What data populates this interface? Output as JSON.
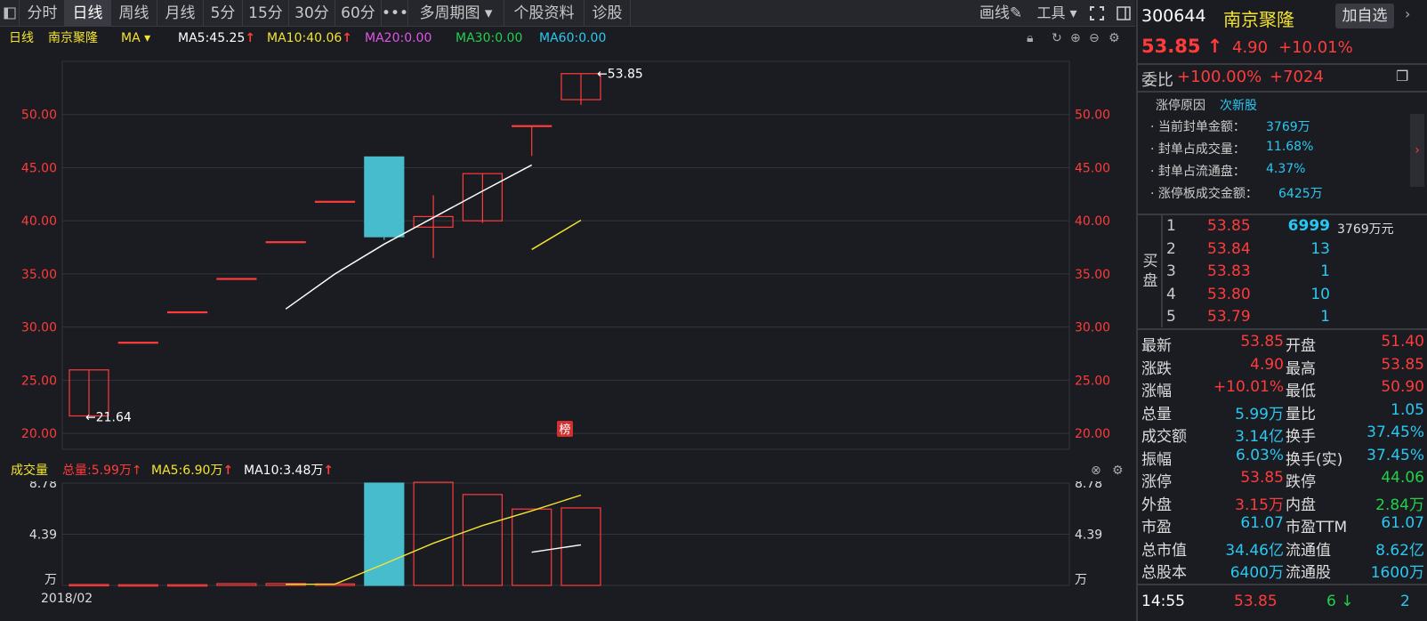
{
  "tabs": [
    "分时",
    "日线",
    "周线",
    "月线",
    "5分",
    "15分",
    "30分",
    "60分",
    "•••",
    "多周期图 ▾",
    "个股资料",
    "诊股"
  ],
  "active_tab": "日线",
  "toolbar": {
    "draw": "画线",
    "tools": "工具 ▾"
  },
  "indicator": {
    "period": "日线",
    "stock": "南京聚隆",
    "ma_select": "MA ▾",
    "ma5": "MA5:45.25",
    "ma10": "MA10:40.06",
    "ma20": "MA20:0.00",
    "ma30": "MA30:0.00",
    "ma60": "MA60:0.00"
  },
  "volume_header": {
    "label": "成交量",
    "total": "总量:5.99万",
    "ma5": "MA5:6.90万",
    "ma10": "MA10:3.48万"
  },
  "colors": {
    "up": "#ff3b3b",
    "down": "#46bccd",
    "ma5": "#ffffff",
    "ma10": "#f3e432",
    "ma20": "#e055e8",
    "ma30": "#1fd14b",
    "ma60": "#29c8f2"
  },
  "chart_data": {
    "type": "candlestick",
    "price_axis": {
      "ylim": [
        18.5,
        55
      ],
      "ticks": [
        "50.00",
        "45.00",
        "40.00",
        "35.00",
        "30.00",
        "25.00",
        "20.00"
      ]
    },
    "candles": [
      {
        "open": 21.64,
        "close": 25.97,
        "high": 25.97,
        "low": 21.64
      },
      {
        "open": 28.57,
        "close": 28.57,
        "high": 28.57,
        "low": 28.57
      },
      {
        "open": 31.43,
        "close": 31.43,
        "high": 31.43,
        "low": 31.43
      },
      {
        "open": 34.57,
        "close": 34.57,
        "high": 34.57,
        "low": 34.57
      },
      {
        "open": 38.03,
        "close": 38.03,
        "high": 38.03,
        "low": 38.03
      },
      {
        "open": 41.83,
        "close": 41.83,
        "high": 41.83,
        "low": 41.83
      },
      {
        "open": 46.01,
        "close": 38.5,
        "high": 46.01,
        "low": 38.2
      },
      {
        "open": 39.4,
        "close": 40.4,
        "high": 42.4,
        "low": 36.5
      },
      {
        "open": 40.0,
        "close": 44.44,
        "high": 44.44,
        "low": 39.8
      },
      {
        "open": 48.95,
        "close": 48.95,
        "high": 48.95,
        "low": 46.1
      },
      {
        "open": 51.4,
        "close": 53.85,
        "high": 53.85,
        "low": 50.9
      }
    ],
    "ma5": [
      null,
      null,
      null,
      null,
      31.7,
      35.0,
      37.8,
      40.3,
      42.8,
      45.25
    ],
    "ma10": [
      null,
      null,
      null,
      null,
      null,
      null,
      null,
      null,
      null,
      37.3,
      40.06
    ],
    "annotations": {
      "max_label": "←53.85",
      "min_label": "←21.64"
    },
    "volume": {
      "axis_labels": [
        "8.78",
        "4.39",
        "万"
      ],
      "ylim": [
        0,
        8.78
      ],
      "values": [
        0.08,
        0.06,
        0.06,
        0.15,
        0.16,
        0.13,
        8.78,
        8.85,
        7.8,
        6.55,
        6.65
      ],
      "ma5": [
        null,
        null,
        null,
        null,
        0.1,
        0.11,
        1.84,
        3.62,
        5.14,
        6.4,
        7.75
      ],
      "ma10": [
        null,
        null,
        null,
        null,
        null,
        null,
        null,
        null,
        null,
        2.85,
        3.48
      ]
    },
    "x_label": "2018/02",
    "badge": "榜"
  },
  "quote": {
    "code": "300644",
    "name": "南京聚隆",
    "add_button": "加自选",
    "price": "53.85 ↑",
    "change": "4.90",
    "change_pct": "+10.01%",
    "weibi_label": "委比",
    "weibi": "+100.00%",
    "weicha": "+7024",
    "limit_reason_label": "涨停原因",
    "limit_reason": "次新股",
    "info": [
      {
        "label": "· 当前封单金额：",
        "value": "3769万"
      },
      {
        "label": "· 封单占成交量：",
        "value": "11.68%"
      },
      {
        "label": "· 封单占流通盘：",
        "value": "4.37%"
      },
      {
        "label": "· 涨停板成交金额：",
        "value": "6425万"
      }
    ],
    "bid_label": "买盘",
    "bids": [
      {
        "level": "1",
        "price": "53.85",
        "volume": "6999",
        "amount": "3769万元"
      },
      {
        "level": "2",
        "price": "53.84",
        "volume": "13",
        "amount": ""
      },
      {
        "level": "3",
        "price": "53.83",
        "volume": "1",
        "amount": ""
      },
      {
        "level": "4",
        "price": "53.80",
        "volume": "10",
        "amount": ""
      },
      {
        "level": "5",
        "price": "53.79",
        "volume": "1",
        "amount": ""
      }
    ],
    "stats": [
      {
        "l1": "最新",
        "v1": "53.85",
        "c1": "red",
        "l2": "开盘",
        "v2": "51.40",
        "c2": "red"
      },
      {
        "l1": "涨跌",
        "v1": "4.90",
        "c1": "red",
        "l2": "最高",
        "v2": "53.85",
        "c2": "red"
      },
      {
        "l1": "涨幅",
        "v1": "+10.01%",
        "c1": "red",
        "l2": "最低",
        "v2": "50.90",
        "c2": "red"
      },
      {
        "l1": "总量",
        "v1": "5.99万",
        "c1": "cyan",
        "l2": "量比",
        "v2": "1.05",
        "c2": "cyan"
      },
      {
        "l1": "成交额",
        "v1": "3.14亿",
        "c1": "cyan",
        "l2": "换手",
        "v2": "37.45%",
        "c2": "cyan"
      },
      {
        "l1": "振幅",
        "v1": "6.03%",
        "c1": "cyan",
        "l2": "换手(实)",
        "v2": "37.45%",
        "c2": "cyan"
      },
      {
        "l1": "涨停",
        "v1": "53.85",
        "c1": "red",
        "l2": "跌停",
        "v2": "44.06",
        "c2": "green"
      },
      {
        "l1": "外盘",
        "v1": "3.15万",
        "c1": "red",
        "l2": "内盘",
        "v2": "2.84万",
        "c2": "green"
      },
      {
        "l1": "市盈",
        "v1": "61.07",
        "c1": "cyan",
        "l2": "市盈TTM",
        "v2": "61.07",
        "c2": "cyan"
      },
      {
        "l1": "总市值",
        "v1": "34.46亿",
        "c1": "cyan",
        "l2": "流通值",
        "v2": "8.62亿",
        "c2": "cyan"
      },
      {
        "l1": "总股本",
        "v1": "6400万",
        "c1": "cyan",
        "l2": "流通股",
        "v2": "1600万",
        "c2": "cyan"
      }
    ],
    "tick": {
      "time": "14:55",
      "price": "53.85",
      "volume": "6 ↓",
      "count": "2"
    }
  }
}
